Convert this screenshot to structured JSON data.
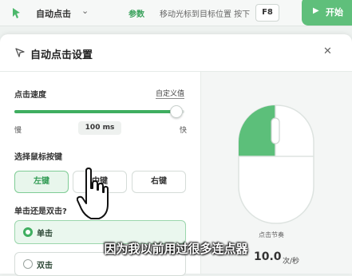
{
  "topbar": {
    "app_title": "自动点击",
    "param_label": "参数",
    "hint": "移动光标到目标位置 按下",
    "hotkey": "F8",
    "start_label": "开始"
  },
  "dialog": {
    "title": "自动点击设置",
    "speed": {
      "label": "点击速度",
      "custom_link": "自定义值",
      "slow_label": "慢",
      "fast_label": "快",
      "value": "100 ms",
      "level": 0.95
    },
    "mouse_button": {
      "label": "选择鼠标按键",
      "options": [
        "左键",
        "中键",
        "右键"
      ],
      "selected": "左键"
    },
    "click_type": {
      "label": "单击还是双击?",
      "options": [
        "单击",
        "双击"
      ],
      "selected": "单击"
    },
    "preview": {
      "rate_label": "点击节奏",
      "rate_value": "10.0",
      "rate_unit": "次/秒"
    }
  },
  "caption": "因为我以前用过很多连点器",
  "colors": {
    "accent": "#3fae60",
    "start": "#5fbf7b",
    "mouse_left": "#5cbf7a"
  }
}
